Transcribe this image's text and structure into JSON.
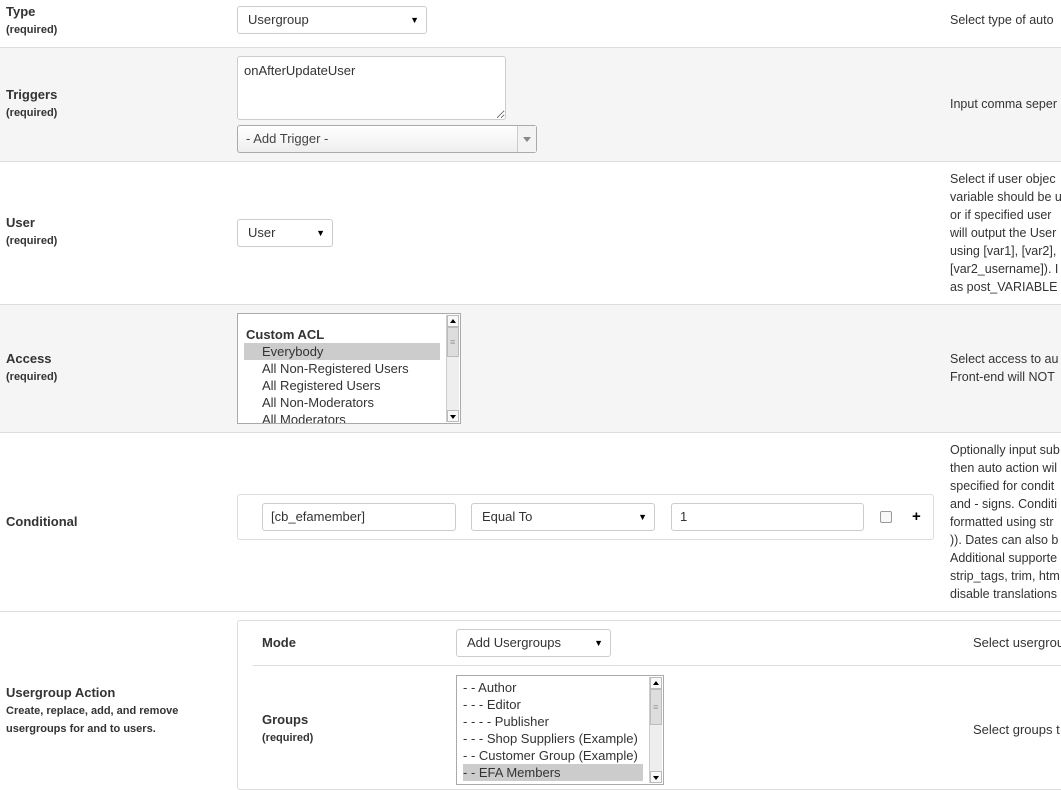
{
  "type_field": {
    "label": "Type",
    "required": "(required)",
    "value": "Usergroup",
    "help": "Select type of auto"
  },
  "triggers_field": {
    "label": "Triggers",
    "required": "(required)",
    "value": "onAfterUpdateUser",
    "add_trigger": "- Add Trigger -",
    "help": "Input comma seper"
  },
  "user_field": {
    "label": "User",
    "required": "(required)",
    "value": "User",
    "help": [
      "Select if user objec",
      "variable should be u",
      "or if specified user",
      "will output the User",
      "using [var1], [var2],",
      "[var2_username]). I",
      "as post_VARIABLE"
    ]
  },
  "access_field": {
    "label": "Access",
    "required": "(required)",
    "group_header": "Custom ACL",
    "options": [
      "Everybody",
      "All Non-Registered Users",
      "All Registered Users",
      "All Non-Moderators",
      "All Moderators"
    ],
    "selected": "Everybody",
    "help": [
      "Select access to au",
      "Front-end will NOT"
    ]
  },
  "conditional_field": {
    "label": "Conditional",
    "field_value": "[cb_efamember]",
    "operator": "Equal To",
    "compare_value": "1",
    "add_label": "+",
    "help": [
      "Optionally input sub",
      "then auto action wil",
      "specified for condit",
      "and - signs. Conditi",
      "formatted using str",
      ")). Dates can also b",
      "Additional supporte",
      "strip_tags, trim, htm",
      "disable translations"
    ]
  },
  "usergroup_action": {
    "label": "Usergroup Action",
    "description_lines": [
      "Create, replace, add, and remove",
      "usergroups for and to users."
    ],
    "mode": {
      "label": "Mode",
      "value": "Add Usergroups",
      "help": "Select usergrou"
    },
    "groups": {
      "label": "Groups",
      "required": "(required)",
      "options": [
        "- - Author",
        "- - - Editor",
        "- - - - Publisher",
        "- - - Shop Suppliers (Example)",
        "- - Customer Group (Example)",
        "- - EFA Members"
      ],
      "selected": "- - EFA Members",
      "help": "Select groups t"
    }
  }
}
